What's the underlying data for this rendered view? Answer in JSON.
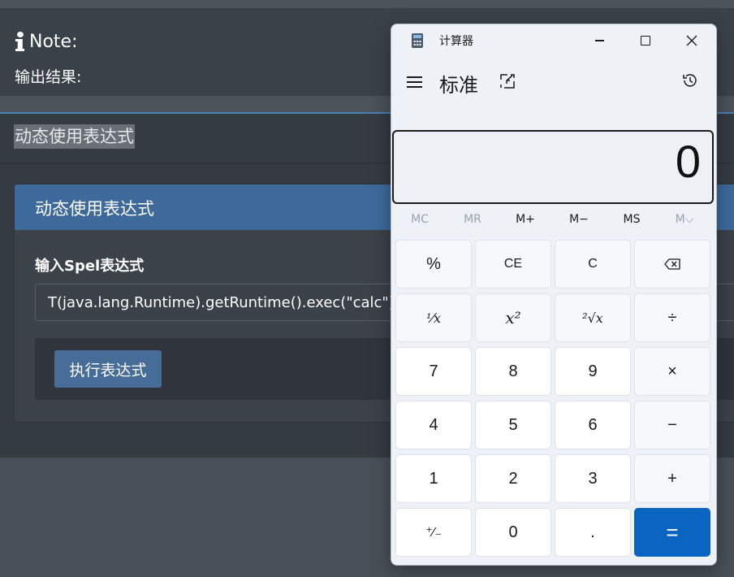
{
  "page": {
    "note_title": "Note:",
    "note_subtitle": "输出结果:",
    "section_title": "动态使用表达式",
    "card": {
      "title": "动态使用表达式",
      "field_label": "输入Spel表达式",
      "expression_value": "T(java.lang.Runtime).getRuntime().exec(\"calc\")",
      "execute_label": "执行表达式"
    }
  },
  "calculator": {
    "window_title": "计算器",
    "mode": "标准",
    "display": "0",
    "memory": [
      {
        "label": "MC",
        "enabled": false
      },
      {
        "label": "MR",
        "enabled": false
      },
      {
        "label": "M+",
        "enabled": true
      },
      {
        "label": "M−",
        "enabled": true
      },
      {
        "label": "MS",
        "enabled": true
      },
      {
        "label": "M⌵",
        "enabled": false
      }
    ],
    "keys": {
      "percent": "%",
      "ce": "CE",
      "c": "C",
      "reciprocal": "⅟x",
      "square": "x²",
      "sqrt": "²√x",
      "divide": "÷",
      "seven": "7",
      "eight": "8",
      "nine": "9",
      "multiply": "×",
      "four": "4",
      "five": "5",
      "six": "6",
      "minus": "−",
      "one": "1",
      "two": "2",
      "three": "3",
      "plus": "+",
      "negate": "⁺∕₋",
      "zero": "0",
      "decimal": ".",
      "equals": "="
    }
  },
  "colors": {
    "accent_blue": "#0a65c2",
    "card_header": "#3d6a9b",
    "page_bg": "#343b41"
  },
  "icons": [
    "info-icon",
    "calculator-app-icon",
    "minimize-icon",
    "maximize-icon",
    "close-icon",
    "hamburger-menu-icon",
    "keep-on-top-icon",
    "history-icon",
    "backspace-icon"
  ]
}
